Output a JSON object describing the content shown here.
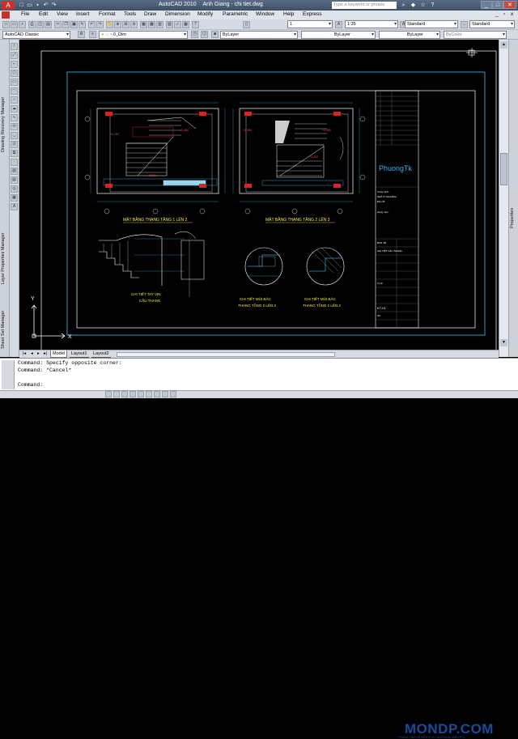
{
  "window": {
    "app_title": "AutoCAD 2010",
    "user": "Anh Giang - chi tiet.dwg",
    "search_placeholder": "Type a keyword or phrase",
    "min": "_",
    "max": "□",
    "close": "✕"
  },
  "menu": [
    "File",
    "Edit",
    "View",
    "Insert",
    "Format",
    "Tools",
    "Draw",
    "Dimension",
    "Modify",
    "Parametric",
    "Window",
    "Help",
    "Express"
  ],
  "toolbar1": {
    "scale_value": "1",
    "annotation_scale": "1:35",
    "text_style": "Standard",
    "dim_style": "Standard"
  },
  "toolbar2": {
    "workspace": "AutoCAD Classic",
    "layer": "0_Dim",
    "color": "ByLayer",
    "linetype": "ByLayer",
    "lineweight": "ByLayer",
    "plotstyle": "ByColor"
  },
  "palettes": {
    "left_tabs": [
      "Drawing Recovery Manager",
      "Layer Properties Manager",
      "Sheet Set Manager"
    ],
    "right_tab": "Properties"
  },
  "layout_tabs": [
    "Model",
    "Layout1",
    "Layout2"
  ],
  "command_lines": [
    "Command: Specify opposite corner:",
    "Command: *Cancel*",
    "",
    "Command:"
  ],
  "branding": {
    "logo": "MONDP.COM",
    "tagline": "TRANG CHIA SẺ KIẾN THỨC AUTOCAD MIỄN PHÍ"
  },
  "drawing": {
    "plan1_title": "MẶT BẰNG THANG TẦNG 1 LÊN 2",
    "plan2_title": "MẶT BẰNG THANG TẦNG 2 LÊN 3",
    "detail_rail_title_1": "CHI TIẾT TAY VỊN",
    "detail_rail_title_2": "CẦU THANG",
    "detail_nose1_title_1": "CHI TIẾT MŨI BẬC",
    "detail_nose1_title_2": "THANG TẦNG 2 LÊN 3",
    "detail_nose2_title_1": "CHI TIẾT MŨI BẬC",
    "detail_nose2_title_2": "THANG TẦNG 1 LÊN 2",
    "titleblock_brand": "PhuongTk",
    "sheet_no": "KT-01",
    "titleblock_rows": [
      "Công trình:",
      "NHÀ Ở GIA ĐÌNH",
      "Địa chỉ:",
      "Hạng mục:",
      "BẢN VẼ:",
      "CHI TIẾT CẦU THANG",
      "Tỷ lệ:",
      "Số:"
    ],
    "levels": [
      "+2.150",
      "+3.450",
      "+0.000",
      "+3.300",
      "+4.500",
      "+3.300"
    ],
    "ucs_x": "X",
    "ucs_y": "Y"
  }
}
